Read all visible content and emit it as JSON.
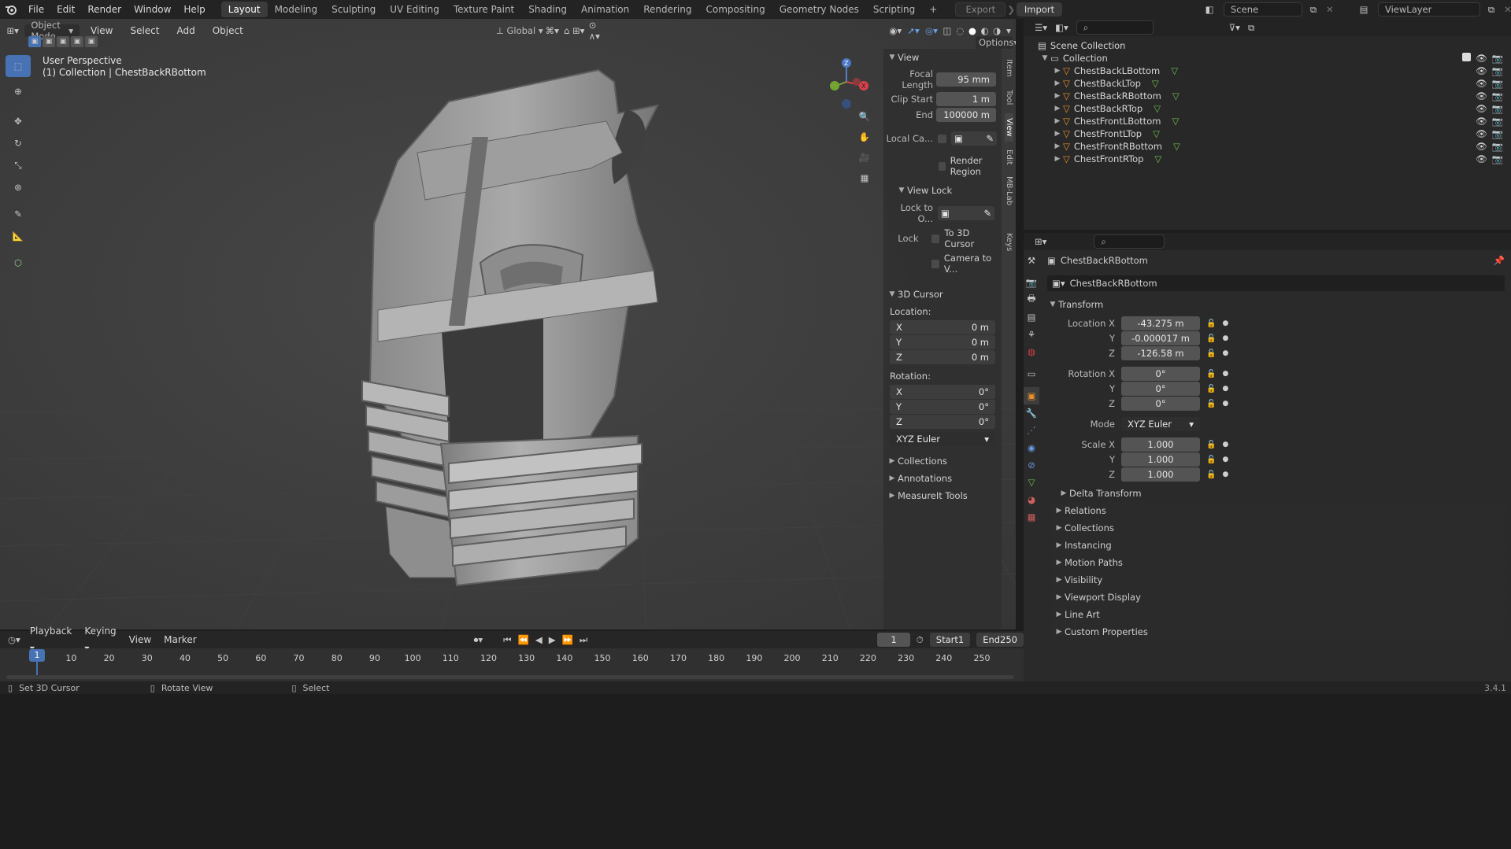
{
  "menu": [
    "File",
    "Edit",
    "Render",
    "Window",
    "Help"
  ],
  "workspaces": [
    "Layout",
    "Modeling",
    "Sculpting",
    "UV Editing",
    "Texture Paint",
    "Shading",
    "Animation",
    "Rendering",
    "Compositing",
    "Geometry Nodes",
    "Scripting"
  ],
  "export_label": "Export",
  "import_label": "Import",
  "scene_name": "Scene",
  "view_layer": "ViewLayer",
  "viewport": {
    "mode": "Object Mode",
    "menu": [
      "View",
      "Select",
      "Add",
      "Object"
    ],
    "orientation": "Global",
    "options": "Options",
    "perspective": "User Perspective",
    "collection_info": "(1) Collection | ChestBackRBottom",
    "tabs": [
      "Item",
      "Tool",
      "View",
      "Edit",
      "MB-Lab",
      "Screencast Keys"
    ]
  },
  "npanel": {
    "view_title": "View",
    "focal_length_label": "Focal Length",
    "focal_length": "95 mm",
    "clip_start_label": "Clip Start",
    "clip_start": "1 m",
    "end_label": "End",
    "clip_end": "100000 m",
    "local_camera_label": "Local Ca...",
    "render_region_label": "Render Region",
    "view_lock_title": "View Lock",
    "lock_to_object_label": "Lock to O...",
    "lock_label": "Lock",
    "to_3d_cursor_label": "To 3D Cursor",
    "camera_to_view_label": "Camera to V...",
    "cursor_title": "3D Cursor",
    "location_label": "Location:",
    "rotation_label": "Rotation:",
    "axes": [
      "X",
      "Y",
      "Z"
    ],
    "loc": [
      "0 m",
      "0 m",
      "0 m"
    ],
    "rot": [
      "0°",
      "0°",
      "0°"
    ],
    "rot_mode": "XYZ Euler",
    "collections": "Collections",
    "annotations": "Annotations",
    "measureit": "MeasureIt Tools"
  },
  "outliner": {
    "scene_collection": "Scene Collection",
    "collection": "Collection",
    "objects": [
      "ChestBackLBottom",
      "ChestBackLTop",
      "ChestBackRBottom",
      "ChestBackRTop",
      "ChestFrontLBottom",
      "ChestFrontLTop",
      "ChestFrontRBottom",
      "ChestFrontRTop"
    ]
  },
  "properties": {
    "object_name": "ChestBackRBottom",
    "data_name": "ChestBackRBottom",
    "transform": "Transform",
    "location_x_label": "Location X",
    "location": [
      "-43.275 m",
      "-0.000017 m",
      "-126.58 m"
    ],
    "rotation_x_label": "Rotation X",
    "rotation": [
      "0°",
      "0°",
      "0°"
    ],
    "mode_label": "Mode",
    "mode": "XYZ Euler",
    "scale_x_label": "Scale X",
    "scale": [
      "1.000",
      "1.000",
      "1.000"
    ],
    "y_label": "Y",
    "z_label": "Z",
    "delta_transform": "Delta Transform",
    "sections": [
      "Relations",
      "Collections",
      "Instancing",
      "Motion Paths",
      "Visibility",
      "Viewport Display",
      "Line Art",
      "Custom Properties"
    ]
  },
  "timeline": {
    "menu": [
      "Playback",
      "Keying",
      "View",
      "Marker"
    ],
    "current_frame": "1",
    "start_label": "Start",
    "start": "1",
    "end_label": "End",
    "end": "250",
    "ticks": [
      "10",
      "20",
      "30",
      "40",
      "50",
      "60",
      "70",
      "80",
      "90",
      "100",
      "110",
      "120",
      "130",
      "140",
      "150",
      "160",
      "170",
      "180",
      "190",
      "200",
      "210",
      "220",
      "230",
      "240",
      "250"
    ]
  },
  "status": {
    "left": "Set 3D Cursor",
    "middle": "Rotate View",
    "right": "Select",
    "version": "3.4.1"
  },
  "colors": {
    "accent": "#4772b3",
    "mesh_icon": "#e8902c",
    "modifier_icon": "#6fbf4a",
    "viewport_bg": "#3d3d3d"
  }
}
